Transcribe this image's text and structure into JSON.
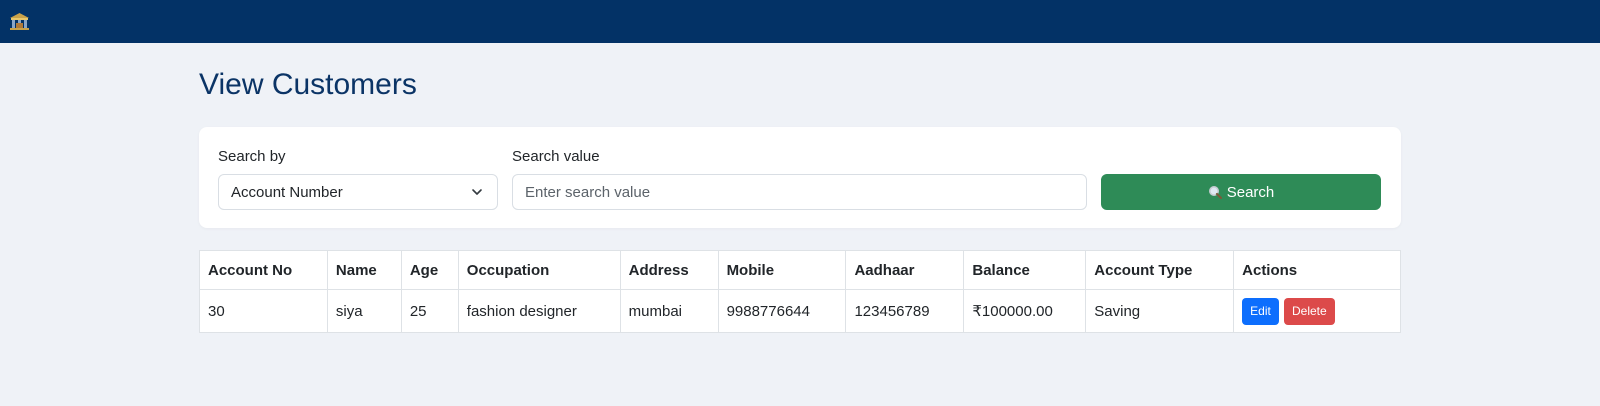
{
  "navbar": {
    "logo_icon": "bank-building-icon",
    "background_color": "#033266"
  },
  "page": {
    "title": "View Customers"
  },
  "search": {
    "by_label": "Search by",
    "by_selected": "Account Number",
    "value_label": "Search value",
    "value_placeholder": "Enter search value",
    "value_current": "",
    "button_label": "Search",
    "button_icon": "magnifier-icon",
    "button_color": "#2e8b57"
  },
  "table": {
    "columns": [
      "Account No",
      "Name",
      "Age",
      "Occupation",
      "Address",
      "Mobile",
      "Aadhaar",
      "Balance",
      "Account Type",
      "Actions"
    ],
    "rows": [
      {
        "account_no": "30",
        "name": "siya",
        "age": "25",
        "occupation": "fashion designer",
        "address": "mumbai",
        "mobile": "9988776644",
        "aadhaar": "123456789",
        "balance": "₹100000.00",
        "account_type": "Saving",
        "edit_label": "Edit",
        "delete_label": "Delete"
      }
    ]
  },
  "colors": {
    "page_background": "#eff2f7",
    "title": "#0b3466",
    "edit_button": "#0d6efd",
    "delete_button": "#dc4a4a"
  }
}
